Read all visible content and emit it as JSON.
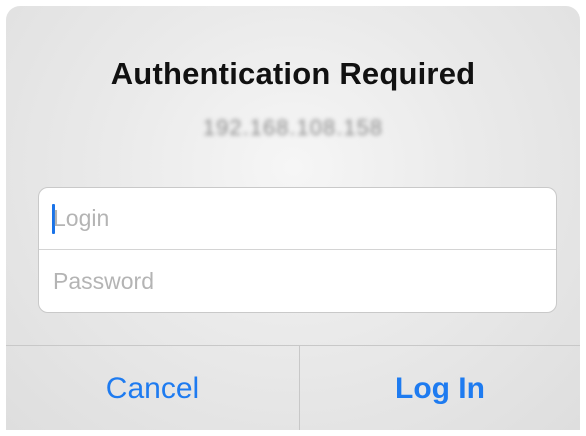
{
  "dialog": {
    "title": "Authentication Required",
    "host": "192.168.108.158"
  },
  "fields": {
    "login": {
      "value": "",
      "placeholder": "Login"
    },
    "password": {
      "value": "",
      "placeholder": "Password"
    }
  },
  "buttons": {
    "cancel_label": "Cancel",
    "login_label": "Log In"
  },
  "colors": {
    "accent": "#1e7bf0",
    "caret": "#1a73e8",
    "title": "#111111",
    "placeholder": "#b4b4b4"
  }
}
